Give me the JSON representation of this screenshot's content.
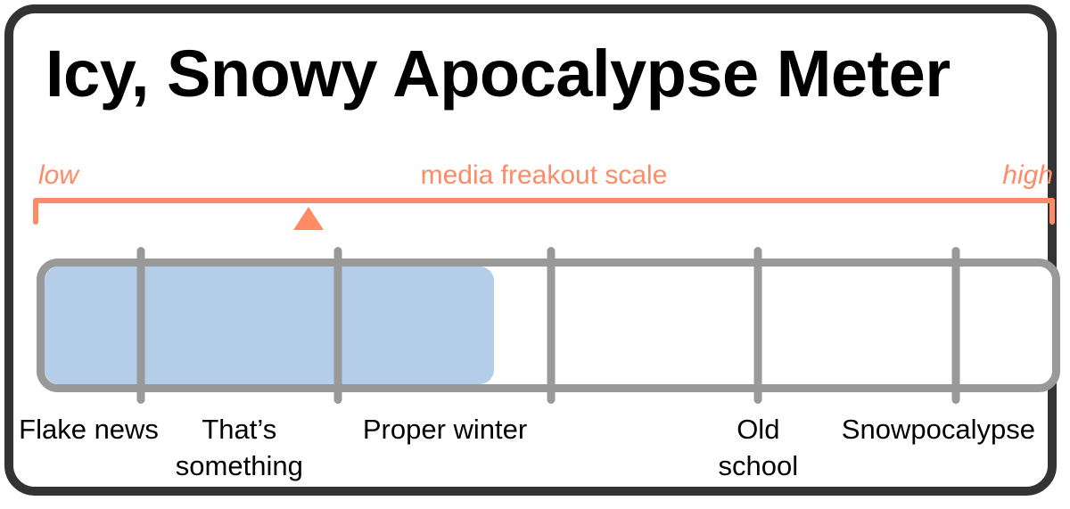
{
  "card": {
    "title": "Icy, Snowy Apocalypse Meter",
    "border_color": "#333333",
    "background": "#ffffff"
  },
  "scale": {
    "low_label": "low",
    "caption": "media freakout scale",
    "high_label": "high",
    "accent_color": "#FC8B66",
    "marker_icon": "up-triangle-marker-icon",
    "marker_position_pct": 27
  },
  "meter": {
    "fill_color": "#B4CDE8",
    "track_color": "#999999",
    "fill_pct": 44.6,
    "segment_boundaries_pct": [
      10.2,
      29.4,
      50.3,
      70.5,
      89.8
    ],
    "labels": [
      {
        "text": "Flake news",
        "center_pct": 5.1,
        "lines": [
          "Flake news"
        ]
      },
      {
        "text": "That’s something",
        "center_pct": 19.8,
        "lines": [
          "That’s",
          "something"
        ]
      },
      {
        "text": "Proper winter",
        "center_pct": 39.9,
        "lines": [
          "Proper winter"
        ]
      },
      {
        "text": "Old school",
        "center_pct": 70.5,
        "lines": [
          "Old",
          "school"
        ]
      },
      {
        "text": "Snowpocalypse",
        "center_pct": 88.1,
        "lines": [
          "Snowpocalypse"
        ]
      }
    ]
  },
  "chart_data": {
    "type": "bar",
    "title": "Icy, Snowy Apocalypse Meter",
    "subtitle": "media freakout scale",
    "orientation": "horizontal",
    "categories": [
      "Flake news",
      "That’s something",
      "Proper winter",
      "Old school",
      "Snowpocalypse"
    ],
    "values": [
      1,
      1,
      1,
      0,
      0
    ],
    "value_unit": "segment filled",
    "fill_pct": 44.6,
    "marker_position_pct": 27,
    "axis_low_label": "low",
    "axis_high_label": "high",
    "xlabel": "media freakout scale",
    "ylabel": "",
    "grid": false,
    "legend": "none",
    "series": [
      {
        "name": "severity fill",
        "values": [
          44.6
        ]
      }
    ],
    "annotations": [
      {
        "text": "low",
        "position": "axis-left"
      },
      {
        "text": "media freakout scale",
        "position": "axis-center"
      },
      {
        "text": "high",
        "position": "axis-right"
      },
      {
        "text": "current level marker",
        "position": "27%"
      }
    ]
  }
}
